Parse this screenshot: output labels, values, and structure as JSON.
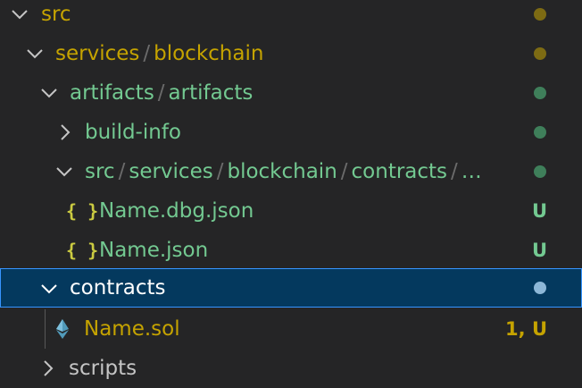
{
  "colors": {
    "modified": "#c5a300",
    "untracked": "#73c991",
    "dot_modified": "#7d6b13",
    "dot_untracked": "#3f7f5a",
    "dot_selected": "#8db7d7",
    "json_icon": "#cbcb41",
    "eth_icon": "#519aba",
    "selected_bg": "#04395e",
    "selected_border": "#3794ff"
  },
  "tree": {
    "src": {
      "label": "src"
    },
    "services_blockchain": {
      "part1": "services",
      "sep": "/",
      "part2": "blockchain"
    },
    "artifacts_artifacts": {
      "part1": "artifacts",
      "sep": "/",
      "part2": "artifacts"
    },
    "build_info": {
      "label": "build-info"
    },
    "deep_path": {
      "p1": "src",
      "p2": "services",
      "p3": "blockchain",
      "p4": "contracts",
      "p5": "…",
      "sep": "/"
    },
    "name_dbg_json": {
      "icon": "{ }",
      "label": "Name.dbg.json",
      "badge": "U"
    },
    "name_json": {
      "icon": "{ }",
      "label": "Name.json",
      "badge": "U"
    },
    "contracts": {
      "label": "contracts"
    },
    "name_sol": {
      "label": "Name.sol",
      "badge": "1, U"
    },
    "scripts": {
      "label": "scripts"
    }
  }
}
